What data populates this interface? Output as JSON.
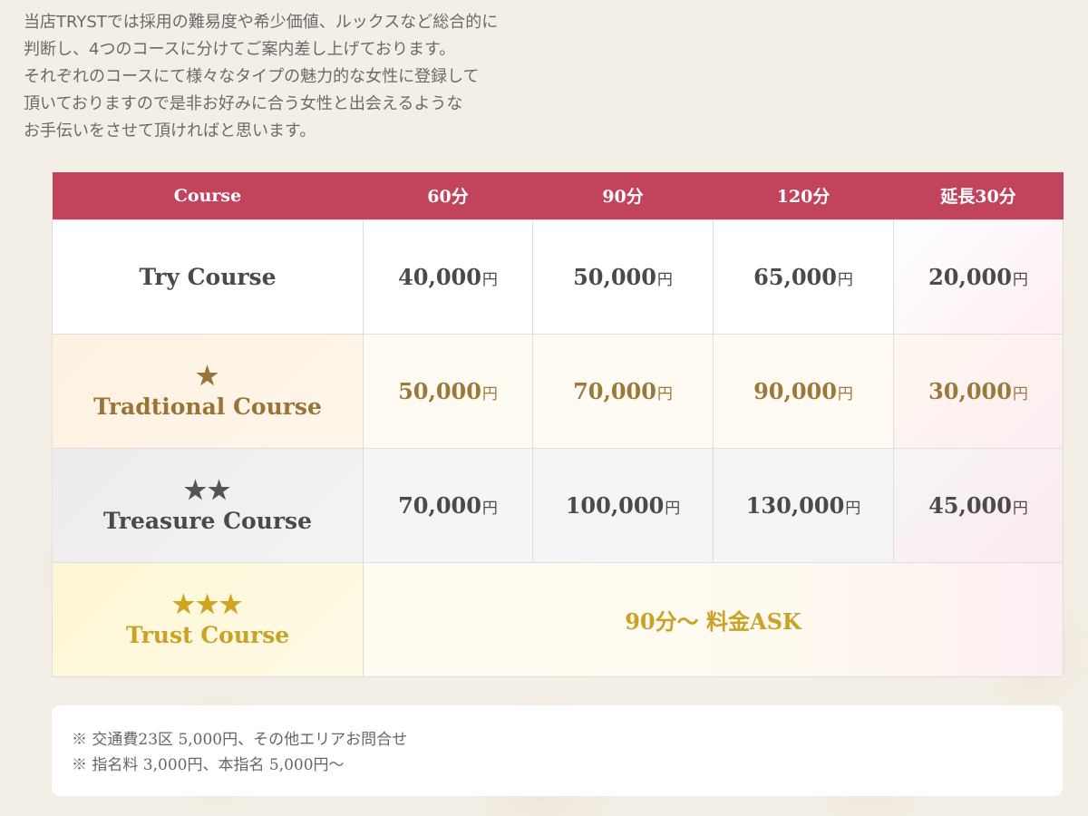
{
  "intro": {
    "lines": [
      "当店TRYSTでは採用の難易度や希少価値、ルックスなど総合的に",
      "判断し、4つのコースに分けてご案内差し上げております。",
      "それぞれのコースにて様々なタイプの魅力的な女性に登録して",
      "頂いておりますので是非お好みに合う女性と出会えるような",
      "お手伝いをさせて頂ければと思います。"
    ]
  },
  "table": {
    "headers": [
      "Course",
      "60分",
      "90分",
      "120分",
      "延長30分"
    ],
    "currency_suffix": "円",
    "rows": [
      {
        "name": "Try Course",
        "stars": "",
        "prices": [
          "40,000",
          "50,000",
          "65,000",
          "20,000"
        ]
      },
      {
        "name": "Tradtional Course",
        "stars": "★",
        "prices": [
          "50,000",
          "70,000",
          "90,000",
          "30,000"
        ]
      },
      {
        "name": "Treasure Course",
        "stars": "★★",
        "prices": [
          "70,000",
          "100,000",
          "130,000",
          "45,000"
        ]
      },
      {
        "name": "Trust Course",
        "stars": "★★★",
        "merged_text": "90分～ 料金ASK"
      }
    ]
  },
  "notes": [
    "※ 交通費23区 5,000円、その他エリアお問合せ",
    "※ 指名料 3,000円、本指名 5,000円～"
  ],
  "colors": {
    "header_bg": "#c1435c",
    "traditional": "#9a7338",
    "treasure": "#555555",
    "trust": "#c9a227"
  }
}
